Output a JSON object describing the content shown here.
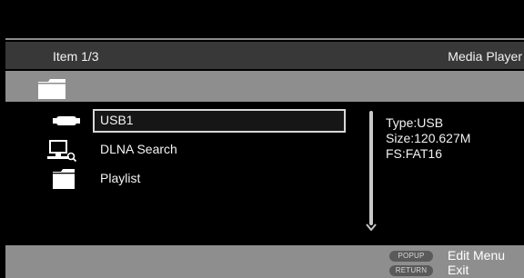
{
  "header": {
    "item_counter": "Item 1/3",
    "app_title": "Media Player"
  },
  "sources": [
    {
      "label": "USB1",
      "icon": "usb-stick-icon",
      "selected": true
    },
    {
      "label": "DLNA Search",
      "icon": "network-pc-icon",
      "selected": false
    },
    {
      "label": "Playlist",
      "icon": "folder-icon",
      "selected": false
    }
  ],
  "details": {
    "type": "Type:USB",
    "size": "Size:120.627M",
    "fs": "FS:FAT16"
  },
  "footer": {
    "popup_button": "POPUP",
    "popup_action": "Edit Menu",
    "return_button": "RETURN",
    "return_action": "Exit"
  },
  "colors": {
    "background": "#000000",
    "info_bar": "#383838",
    "path_bar": "#8e8e8e",
    "selection_border": "#d8d8d8"
  }
}
